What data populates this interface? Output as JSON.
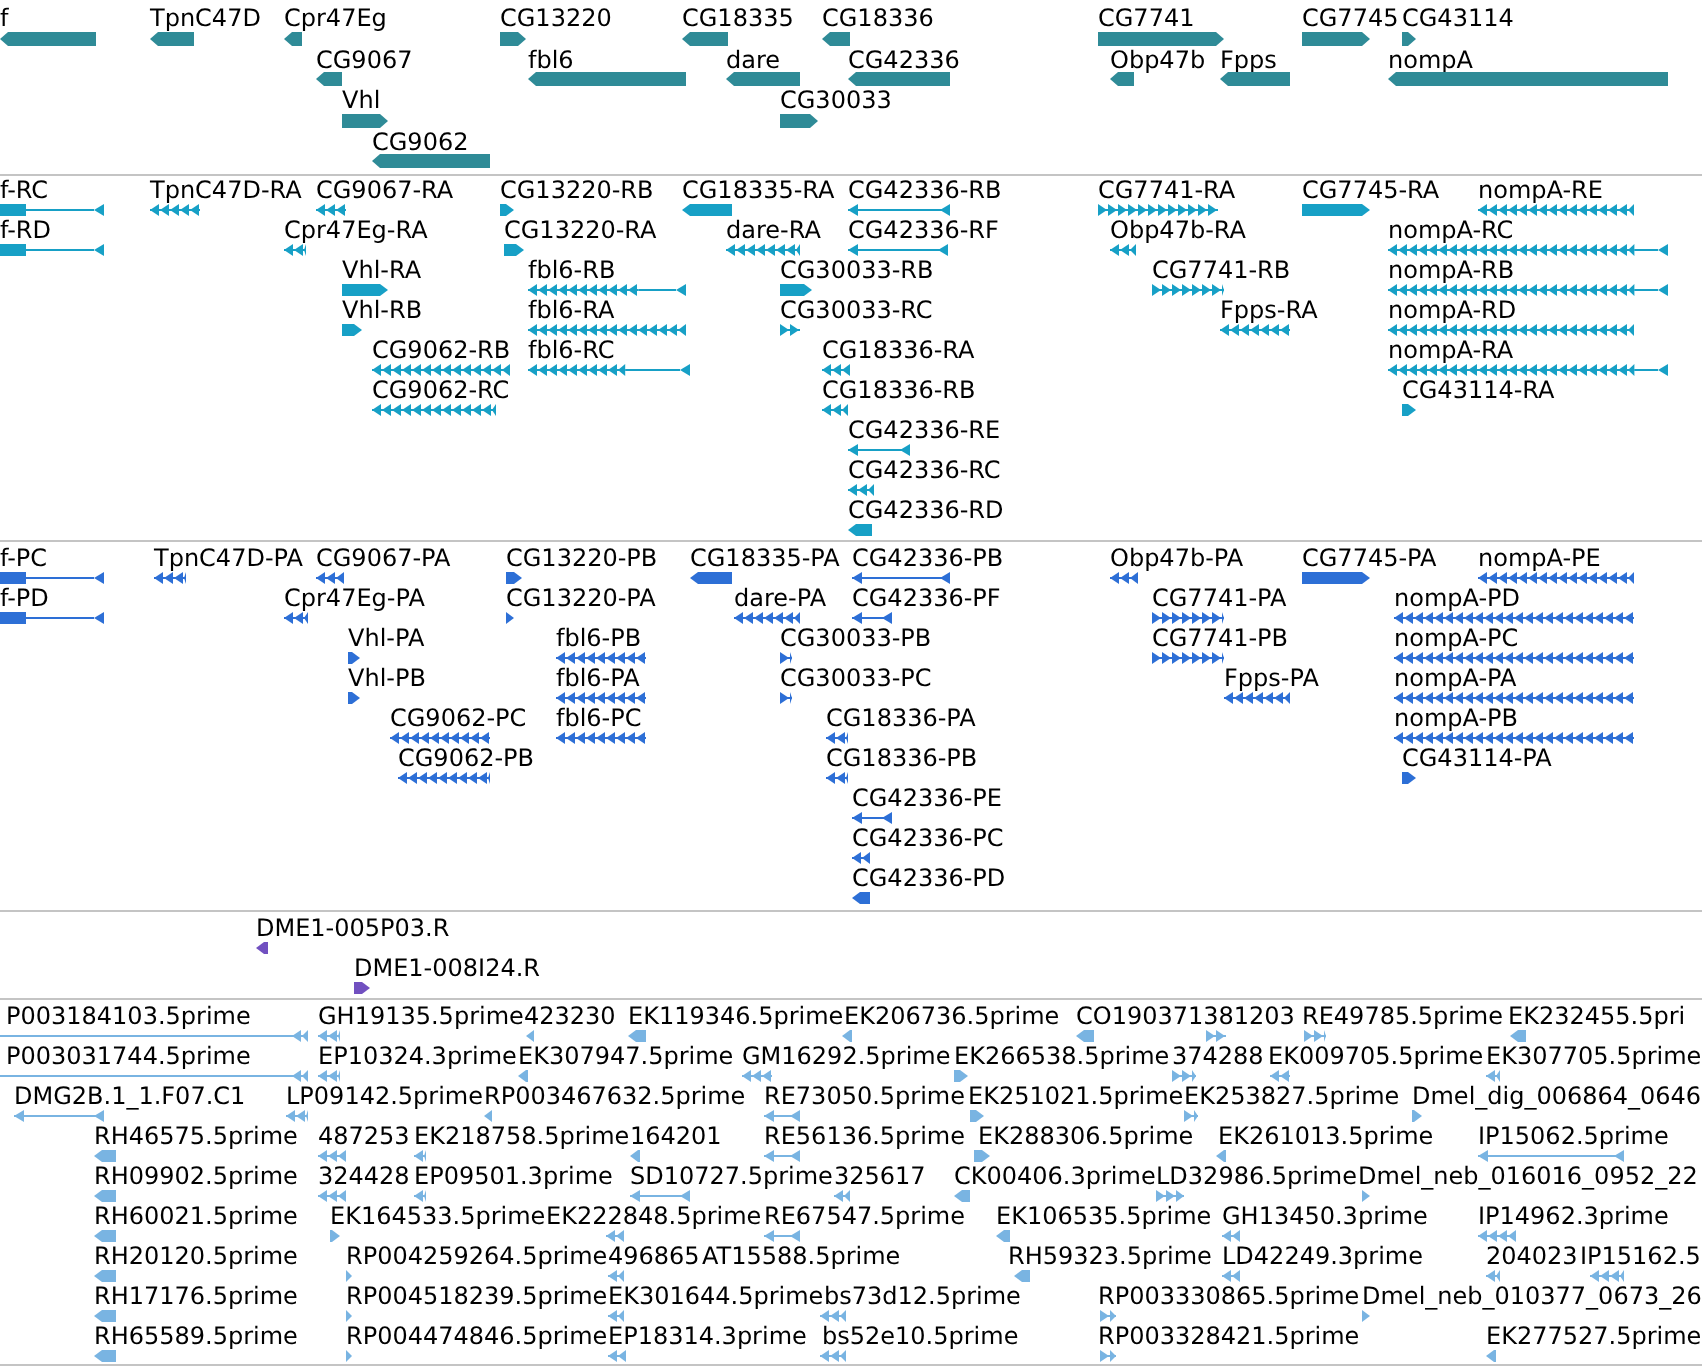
{
  "tracks": [
    {
      "kind": "gene",
      "features": [
        {
          "label": "f",
          "reverse": true
        },
        {
          "label": "TpnC47D",
          "reverse": true
        },
        {
          "label": "Cpr47Eg",
          "reverse": true
        },
        {
          "label": "CG13220",
          "reverse": false
        },
        {
          "label": "CG18335",
          "reverse": true
        },
        {
          "label": "CG18336",
          "reverse": true
        },
        {
          "label": "CG7741",
          "reverse": false
        },
        {
          "label": "CG7745",
          "reverse": false
        },
        {
          "label": "CG43114",
          "reverse": false
        },
        {
          "label": "CG9067",
          "reverse": true
        },
        {
          "label": "fbl6",
          "reverse": true
        },
        {
          "label": "dare",
          "reverse": true
        },
        {
          "label": "CG42336",
          "reverse": true
        },
        {
          "label": "Obp47b",
          "reverse": true
        },
        {
          "label": "Fpps",
          "reverse": true
        },
        {
          "label": "nompA",
          "reverse": true
        },
        {
          "label": "Vhl",
          "reverse": false
        },
        {
          "label": "CG30033",
          "reverse": false
        },
        {
          "label": "CG9062",
          "reverse": true
        }
      ]
    },
    {
      "kind": "mrna",
      "features": [
        {
          "label": "f-RC",
          "reverse": true
        },
        {
          "label": "TpnC47D-RA",
          "reverse": true
        },
        {
          "label": "CG9067-RA",
          "reverse": true
        },
        {
          "label": "CG13220-RB",
          "reverse": false
        },
        {
          "label": "CG18335-RA",
          "reverse": true
        },
        {
          "label": "CG42336-RB",
          "reverse": true
        },
        {
          "label": "CG7741-RA",
          "reverse": false
        },
        {
          "label": "CG7745-RA",
          "reverse": false
        },
        {
          "label": "nompA-RE",
          "reverse": true
        },
        {
          "label": "f-RD",
          "reverse": true
        },
        {
          "label": "Cpr47Eg-RA",
          "reverse": true
        },
        {
          "label": "CG13220-RA",
          "reverse": false
        },
        {
          "label": "dare-RA",
          "reverse": true
        },
        {
          "label": "CG42336-RF",
          "reverse": true
        },
        {
          "label": "Obp47b-RA",
          "reverse": true
        },
        {
          "label": "nompA-RC",
          "reverse": true
        },
        {
          "label": "Vhl-RA",
          "reverse": false
        },
        {
          "label": "fbl6-RB",
          "reverse": true
        },
        {
          "label": "CG30033-RB",
          "reverse": false
        },
        {
          "label": "CG7741-RB",
          "reverse": false
        },
        {
          "label": "nompA-RB",
          "reverse": true
        },
        {
          "label": "Vhl-RB",
          "reverse": false
        },
        {
          "label": "fbl6-RA",
          "reverse": true
        },
        {
          "label": "CG30033-RC",
          "reverse": false
        },
        {
          "label": "Fpps-RA",
          "reverse": true
        },
        {
          "label": "nompA-RD",
          "reverse": true
        },
        {
          "label": "CG9062-RB",
          "reverse": true
        },
        {
          "label": "fbl6-RC",
          "reverse": true
        },
        {
          "label": "CG18336-RA",
          "reverse": true
        },
        {
          "label": "nompA-RA",
          "reverse": true
        },
        {
          "label": "CG9062-RC",
          "reverse": true
        },
        {
          "label": "CG18336-RB",
          "reverse": true
        },
        {
          "label": "CG43114-RA",
          "reverse": false
        },
        {
          "label": "CG42336-RE",
          "reverse": true
        },
        {
          "label": "CG42336-RC",
          "reverse": true
        },
        {
          "label": "CG42336-RD",
          "reverse": true
        }
      ]
    },
    {
      "kind": "polypeptide",
      "features": [
        {
          "label": "f-PC",
          "reverse": true
        },
        {
          "label": "TpnC47D-PA",
          "reverse": true
        },
        {
          "label": "CG9067-PA",
          "reverse": true
        },
        {
          "label": "CG13220-PB",
          "reverse": false
        },
        {
          "label": "CG18335-PA",
          "reverse": true
        },
        {
          "label": "CG42336-PB",
          "reverse": true
        },
        {
          "label": "Obp47b-PA",
          "reverse": true
        },
        {
          "label": "CG7745-PA",
          "reverse": false
        },
        {
          "label": "nompA-PE",
          "reverse": true
        },
        {
          "label": "f-PD",
          "reverse": true
        },
        {
          "label": "Cpr47Eg-PA",
          "reverse": true
        },
        {
          "label": "CG13220-PA",
          "reverse": false
        },
        {
          "label": "dare-PA",
          "reverse": true
        },
        {
          "label": "CG42336-PF",
          "reverse": true
        },
        {
          "label": "CG7741-PA",
          "reverse": false
        },
        {
          "label": "nompA-PD",
          "reverse": true
        },
        {
          "label": "Vhl-PA",
          "reverse": false
        },
        {
          "label": "fbl6-PB",
          "reverse": true
        },
        {
          "label": "CG30033-PB",
          "reverse": false
        },
        {
          "label": "CG7741-PB",
          "reverse": false
        },
        {
          "label": "nompA-PC",
          "reverse": true
        },
        {
          "label": "Vhl-PB",
          "reverse": false
        },
        {
          "label": "fbl6-PA",
          "reverse": true
        },
        {
          "label": "CG30033-PC",
          "reverse": false
        },
        {
          "label": "Fpps-PA",
          "reverse": true
        },
        {
          "label": "nompA-PA",
          "reverse": true
        },
        {
          "label": "CG9062-PC",
          "reverse": true
        },
        {
          "label": "fbl6-PC",
          "reverse": true
        },
        {
          "label": "CG18336-PA",
          "reverse": true
        },
        {
          "label": "nompA-PB",
          "reverse": true
        },
        {
          "label": "CG9062-PB",
          "reverse": true
        },
        {
          "label": "CG18336-PB",
          "reverse": true
        },
        {
          "label": "CG43114-PA",
          "reverse": false
        },
        {
          "label": "CG42336-PE",
          "reverse": true
        },
        {
          "label": "CG42336-PC",
          "reverse": true
        },
        {
          "label": "CG42336-PD",
          "reverse": true
        }
      ]
    },
    {
      "kind": "clone",
      "features": [
        {
          "label": "DME1-005P03.R",
          "reverse": true
        },
        {
          "label": "DME1-008I24.R",
          "reverse": false
        }
      ]
    },
    {
      "kind": "est",
      "features": [
        {
          "label": "P003184103.5prime",
          "reverse": true
        },
        {
          "label": "GH19135.5prime",
          "reverse": true
        },
        {
          "label": "423230",
          "reverse": true
        },
        {
          "label": "EK119346.5prime",
          "reverse": true
        },
        {
          "label": "EK206736.5prime",
          "reverse": true
        },
        {
          "label": "CO190371381203",
          "reverse": true
        },
        {
          "reverse": false
        },
        {
          "label": "RE49785.5prime",
          "reverse": false
        },
        {
          "label": "EK232455.5pri",
          "reverse": true
        },
        {
          "label": "P003031744.5prime",
          "reverse": true
        },
        {
          "label": "EP10324.3prime",
          "reverse": true
        },
        {
          "label": "EK307947.5prime",
          "reverse": true
        },
        {
          "label": "GM16292.5prime",
          "reverse": true
        },
        {
          "label": "EK266538.5prime",
          "reverse": false
        },
        {
          "label": "374288",
          "reverse": false
        },
        {
          "label": "EK009705.5prime",
          "reverse": true
        },
        {
          "label": "EK307705.5prime",
          "reverse": true
        },
        {
          "label": "DMG2B.1_1.F07.C1",
          "reverse": true
        },
        {
          "label": "LP09142.5prime",
          "reverse": true
        },
        {
          "label": "RP003467632.5prime",
          "reverse": true
        },
        {
          "label": "RE73050.5prime",
          "reverse": true
        },
        {
          "label": "EK251021.5prime",
          "reverse": false
        },
        {
          "label": "EK253827.5prime",
          "reverse": false
        },
        {
          "label": "Dmel_dig_006864_0646",
          "reverse": false
        },
        {
          "label": "RH46575.5prime",
          "reverse": true
        },
        {
          "label": "487253",
          "reverse": true
        },
        {
          "label": "EK218758.5prime",
          "reverse": true
        },
        {
          "label": "164201",
          "reverse": true
        },
        {
          "label": "RE56136.5prime",
          "reverse": true
        },
        {
          "label": "EK288306.5prime",
          "reverse": false
        },
        {
          "label": "EK261013.5prime",
          "reverse": true
        },
        {
          "label": "IP15062.5prime",
          "reverse": true
        },
        {
          "label": "RH09902.5prime",
          "reverse": true
        },
        {
          "label": "324428",
          "reverse": true
        },
        {
          "label": "EP09501.3prime",
          "reverse": true
        },
        {
          "label": "SD10727.5prime",
          "reverse": true
        },
        {
          "label": "325617",
          "reverse": true
        },
        {
          "label": "CK00406.3prime",
          "reverse": true
        },
        {
          "label": "LD32986.5prime",
          "reverse": false
        },
        {
          "label": "Dmel_neb_016016_0952_22",
          "reverse": false
        },
        {
          "label": "RH60021.5prime",
          "reverse": true
        },
        {
          "label": "EK164533.5prime",
          "reverse": false
        },
        {
          "label": "EK222848.5prime",
          "reverse": true
        },
        {
          "label": "RE67547.5prime",
          "reverse": true
        },
        {
          "label": "EK106535.5prime",
          "reverse": true
        },
        {
          "label": "GH13450.3prime",
          "reverse": true
        },
        {
          "label": "IP14962.3prime",
          "reverse": true
        },
        {
          "label": "RH20120.5prime",
          "reverse": true
        },
        {
          "label": "RP004259264.5prime",
          "reverse": false
        },
        {
          "label": "496865",
          "reverse": true
        },
        {
          "label": "AT15588.5prime"
        },
        {
          "label": "RH59323.5prime",
          "reverse": true
        },
        {
          "label": "LD42249.3prime",
          "reverse": true
        },
        {
          "label": "204023",
          "reverse": true
        },
        {
          "label": "IP15162.5",
          "reverse": true
        },
        {
          "label": "RH17176.5prime",
          "reverse": true
        },
        {
          "label": "RP004518239.5prime",
          "reverse": false
        },
        {
          "label": "EK301644.5prime",
          "reverse": true
        },
        {
          "label": "bs73d12.5prime",
          "reverse": true
        },
        {
          "label": "RP003330865.5prime",
          "reverse": false
        },
        {
          "label": "Dmel_neb_010377_0673_26",
          "reverse": false
        },
        {
          "label": "RH65589.5prime",
          "reverse": true
        },
        {
          "label": "RP004474846.5prime",
          "reverse": false
        },
        {
          "label": "EP18314.3prime",
          "reverse": true
        },
        {
          "label": "bs52e10.5prime",
          "reverse": true
        },
        {
          "label": "RP003328421.5prime",
          "reverse": false
        },
        {
          "label": "EK277527.5prime",
          "reverse": true
        }
      ]
    }
  ]
}
